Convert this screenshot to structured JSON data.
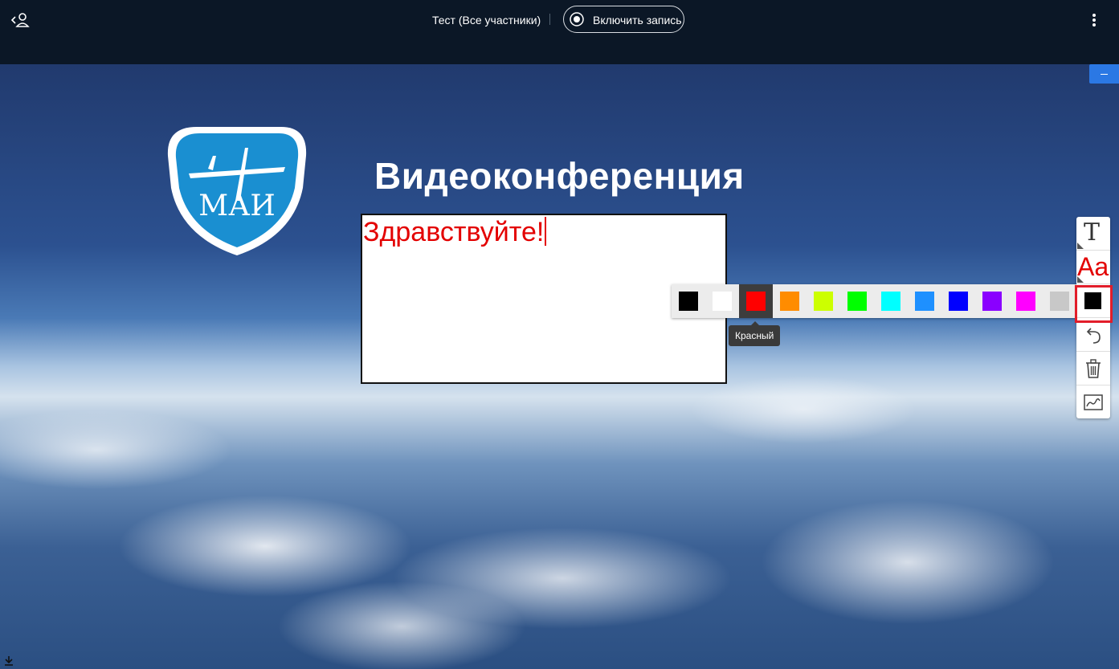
{
  "header": {
    "meeting_title": "Тест (Все участники)",
    "record_button_label": "Включить запись",
    "icons": {
      "back": "back-to-participants-icon",
      "record": "record-icon",
      "more": "more-vertical-icon"
    }
  },
  "slide": {
    "title": "Видеоконференция",
    "logo_text": "МАИ",
    "logo_color": "#1a8fd1",
    "minimize_icon": "minimize-icon",
    "download_icon": "download-icon"
  },
  "annotation": {
    "typed_text": "Здравствуйте!",
    "text_color": "#e30000"
  },
  "palette": {
    "selected_index": 2,
    "tooltip": "Красный",
    "colors": [
      "#000000",
      "#ffffff",
      "#ff0000",
      "#ff8c00",
      "#ccff00",
      "#00ff00",
      "#00ffff",
      "#1e90ff",
      "#0000ff",
      "#8a00ff",
      "#ff00ff",
      "#c8c8c8"
    ]
  },
  "toolbar": {
    "tools": [
      "text-tool",
      "font-size-tool",
      "color-tool",
      "undo-tool",
      "delete-tool",
      "pen-tool"
    ],
    "text_glyph": "T",
    "size_glyph": "Aa",
    "current_color": "#000000"
  }
}
